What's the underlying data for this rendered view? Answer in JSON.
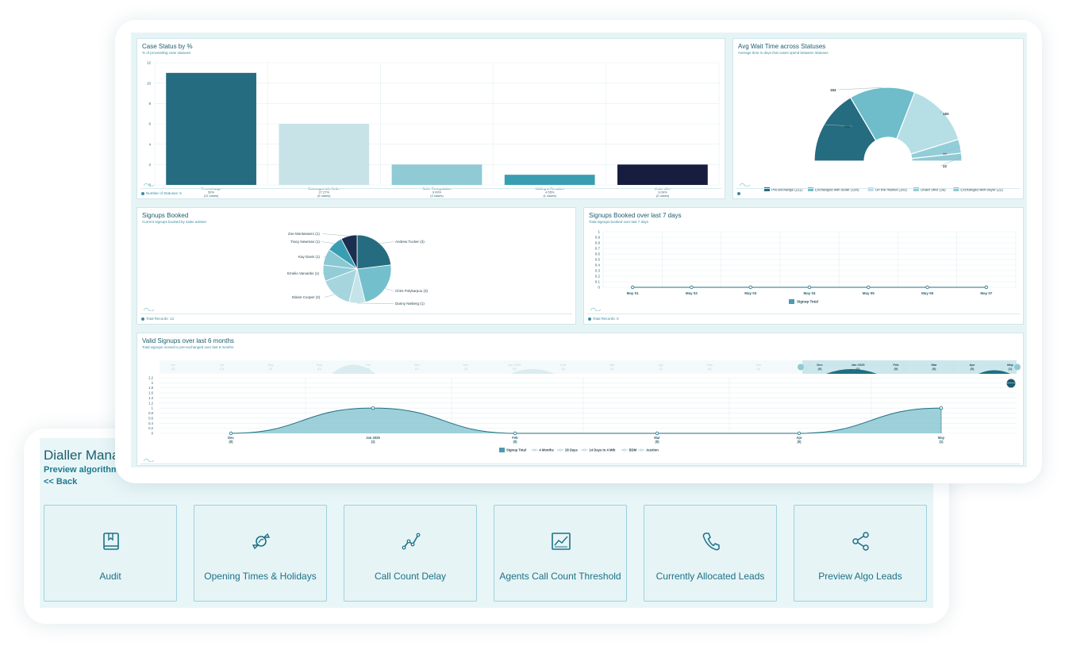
{
  "dialler": {
    "title": "Dialler Manag",
    "subtitle": "Preview algorithm le",
    "back_label": "<< Back",
    "tiles": [
      {
        "label": "Audit",
        "icon": "book-icon"
      },
      {
        "label": "Opening Times & Holidays",
        "icon": "candy-icon"
      },
      {
        "label": "Call Count Delay",
        "icon": "line-graph-icon"
      },
      {
        "label": "Agents Call Count Threshold",
        "icon": "chart-box-icon"
      },
      {
        "label": "Currently Allocated Leads",
        "icon": "phone-icon"
      },
      {
        "label": "Preview Algo Leads",
        "icon": "share-icon"
      }
    ]
  },
  "panels": {
    "case_status": {
      "title": "Case Status by %",
      "subtitle": "% of proceeding case statuses",
      "footer": "Number of Statuses: 5"
    },
    "wait_time": {
      "title": "Avg Wait Time across Statuses",
      "subtitle": "Average time in days that cases spend between statuses"
    },
    "signups": {
      "title": "Signups Booked",
      "subtitle": "Current signups booked by sales adviser",
      "footer": "Total Records: 13"
    },
    "signups_7": {
      "title": "Signups Booked over last 7 days",
      "subtitle": "Total signups booked over last 7 days",
      "footer": "Total Records: 0"
    },
    "valid": {
      "title": "Valid Signups over last 6 months",
      "subtitle": "Total signups moved to pre-exchanged over last 6 months"
    }
  },
  "chart_data": [
    {
      "type": "bar",
      "title": "Case Status by %",
      "categories": [
        "Pre-exchange",
        "Exchanged with Seller",
        "Seller Renegotiation",
        "Waiting to Remarket",
        "Under offer"
      ],
      "category_lines": [
        [
          "Pre-exchange",
          "50%",
          "(11 cases)"
        ],
        [
          "Exchanged with Seller",
          "27.27%",
          "(6 cases)"
        ],
        [
          "Seller Renegotiation",
          "9.09%",
          "(2 cases)"
        ],
        [
          "Waiting to Remarket",
          "4.55%",
          "(1 cases)"
        ],
        [
          "Under offer",
          "9.09%",
          "(2 cases)"
        ]
      ],
      "values": [
        11,
        6,
        2,
        1,
        2
      ],
      "yticks": [
        "0",
        "2",
        "4",
        "6",
        "8",
        "10",
        "12"
      ],
      "ylim": [
        0,
        12
      ],
      "colors": [
        "#266c80",
        "#c8e3e8",
        "#8fcad5",
        "#3a9eb3",
        "#161d3e"
      ]
    },
    {
      "type": "pie",
      "title": "Avg Wait Time across Statuses",
      "labels": [
        "Pre-exchange (211)",
        "Exchanged with seller (184)",
        "On the market (183)",
        "Under offer (39)",
        "Exchanged with buyer (22)"
      ],
      "values": [
        211,
        184,
        183,
        39,
        22
      ],
      "slice_labels": [
        "211",
        "184",
        "183",
        "39",
        "22"
      ],
      "colors": [
        "#266c80",
        "#6fbcca",
        "#b6dee5",
        "#92cdd8",
        "#8fc9d4"
      ]
    },
    {
      "type": "pie",
      "title": "Signups Booked",
      "labels": [
        "Andrew Tucker (3)",
        "Chris Polykarpou (3)",
        "Danny Nieberg (1)",
        "Elaine Cooper (2)",
        "Emelio Varvaritis (1)",
        "Kay Davis (1)",
        "Tracy Newman (1)",
        "Zoe Montanaero (1)"
      ],
      "values": [
        3,
        3,
        1,
        2,
        1,
        1,
        1,
        1
      ],
      "colors": [
        "#266c80",
        "#74bfcc",
        "#c5e4ea",
        "#a6d5de",
        "#93ccd7",
        "#8ac8d3",
        "#3a9eb3",
        "#1a2f4f"
      ]
    },
    {
      "type": "line",
      "title": "Signups Booked over last 7 days",
      "categories": [
        "May 01",
        "May 02",
        "May 03",
        "May 04",
        "May 05",
        "May 06",
        "May 07"
      ],
      "series": [
        {
          "name": "Signup Total",
          "values": [
            0,
            0,
            0,
            0,
            0,
            0,
            0
          ]
        }
      ],
      "yticks": [
        "0",
        "0.1",
        "0.2",
        "0.3",
        "0.4",
        "0.5",
        "0.6",
        "0.7",
        "0.8",
        "0.9",
        "1"
      ],
      "ylim": [
        0,
        1
      ]
    },
    {
      "type": "area",
      "title": "Valid Signups over last 6 months",
      "categories": [
        "Dec",
        "Jan 2025",
        "Feb",
        "Mar",
        "Apr",
        "May"
      ],
      "category_counts": [
        "(0)",
        "(1)",
        "(0)",
        "(0)",
        "(0)",
        "(1)"
      ],
      "series": [
        {
          "name": "Signup Total",
          "values": [
            0,
            1,
            0,
            0,
            0,
            1
          ]
        }
      ],
      "legend": [
        "Signup Total",
        "4 Months",
        "28 Days",
        "14 Days to 4 Mth",
        "BDM",
        "Auction"
      ],
      "yticks": [
        "0",
        "0.2",
        "0.4",
        "0.6",
        "0.8",
        "1",
        "1.2",
        "1.4",
        "1.6",
        "1.8",
        "2",
        "2.2"
      ],
      "ylim": [
        0,
        2.2
      ],
      "navigator": {
        "labels": [
          "Jun",
          "Jul",
          "Aug",
          "Sep",
          "Oct",
          "Nov",
          "Dec",
          "Jan 2025",
          "Feb",
          "Mar",
          "Apr",
          "May",
          "Jun",
          "Jul",
          "Aug",
          "Sep",
          "Oct",
          "Nov"
        ],
        "counts": [
          "(0)",
          "(0)",
          "(0)",
          "(0)",
          "(0)",
          "(0)",
          "(0)",
          "(0)",
          "(0)",
          "(0)",
          "(1)",
          "(0)",
          "(0)",
          "(0)",
          "(0)",
          "(0)",
          "(0)",
          "(0)"
        ],
        "window_labels": [
          "Dec",
          "Jan 2025",
          "Feb",
          "Mar",
          "Apr",
          "May"
        ],
        "window_counts": [
          "(0)",
          "(1)",
          "(0)",
          "(0)",
          "(0)",
          "(1)"
        ]
      }
    }
  ]
}
